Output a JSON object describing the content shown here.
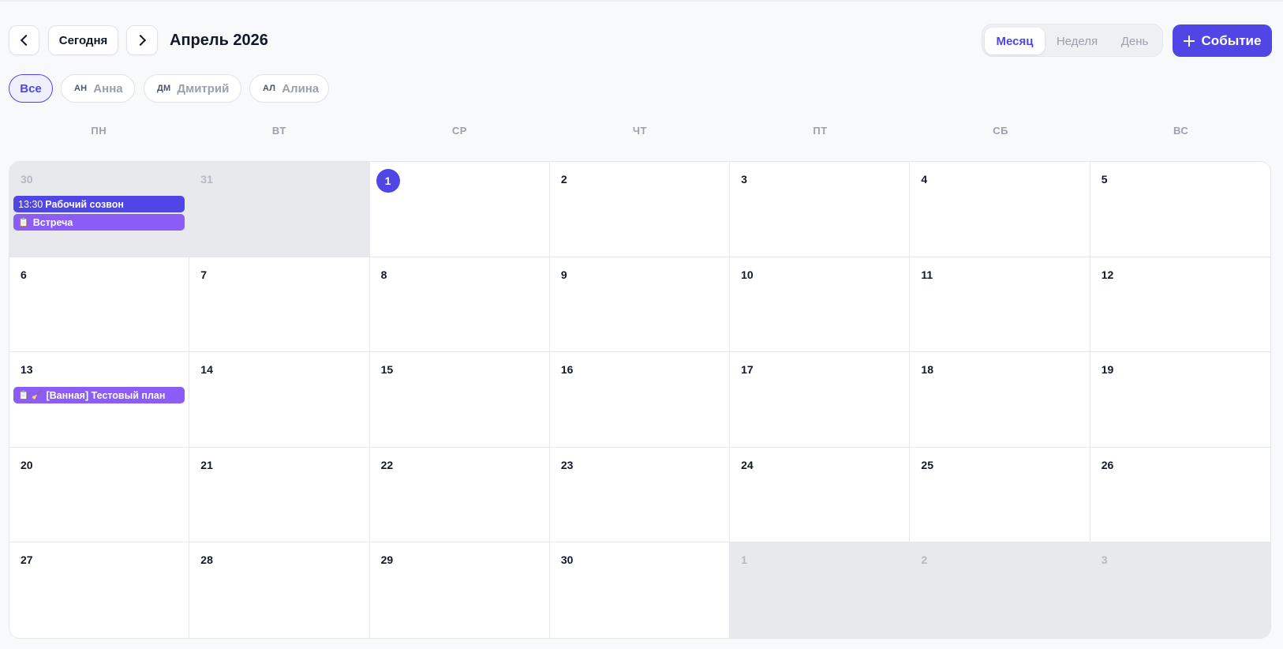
{
  "toolbar": {
    "today_label": "Сегодня",
    "title": "Апрель 2026",
    "views": [
      "Месяц",
      "Неделя",
      "День"
    ],
    "active_view": "Месяц",
    "new_event_label": "Событие"
  },
  "filters": [
    {
      "label": "Все",
      "initials": "",
      "active": true
    },
    {
      "label": "Анна",
      "initials": "АН",
      "active": false
    },
    {
      "label": "Дмитрий",
      "initials": "ДМ",
      "active": false
    },
    {
      "label": "Алина",
      "initials": "АЛ",
      "active": false
    }
  ],
  "weekdays": [
    "ПН",
    "ВТ",
    "СР",
    "ЧТ",
    "ПТ",
    "СБ",
    "ВС"
  ],
  "days": [
    "30",
    "31",
    "1",
    "2",
    "3",
    "4",
    "5",
    "6",
    "7",
    "8",
    "9",
    "10",
    "11",
    "12",
    "13",
    "14",
    "15",
    "16",
    "17",
    "18",
    "19",
    "20",
    "21",
    "22",
    "23",
    "24",
    "25",
    "26",
    "27",
    "28",
    "29",
    "30",
    "1",
    "2",
    "3"
  ],
  "events": [
    {
      "day_index": 0,
      "time": "13:30",
      "title": "Рабочий созвон",
      "icon": "",
      "color": "#4f46e5"
    },
    {
      "day_index": 0,
      "time": "",
      "title": "Встреча",
      "icon": "📋",
      "color": "#8b5cf6"
    },
    {
      "day_index": 14,
      "time": "",
      "title": "[Ванная] Тестовый план",
      "icon": "📋 🧹",
      "color": "#8b5cf6"
    }
  ],
  "colors": {
    "accent": "#4f46e5",
    "event_purple": "#8b5cf6",
    "muted_cell": "#e8e9ed"
  }
}
